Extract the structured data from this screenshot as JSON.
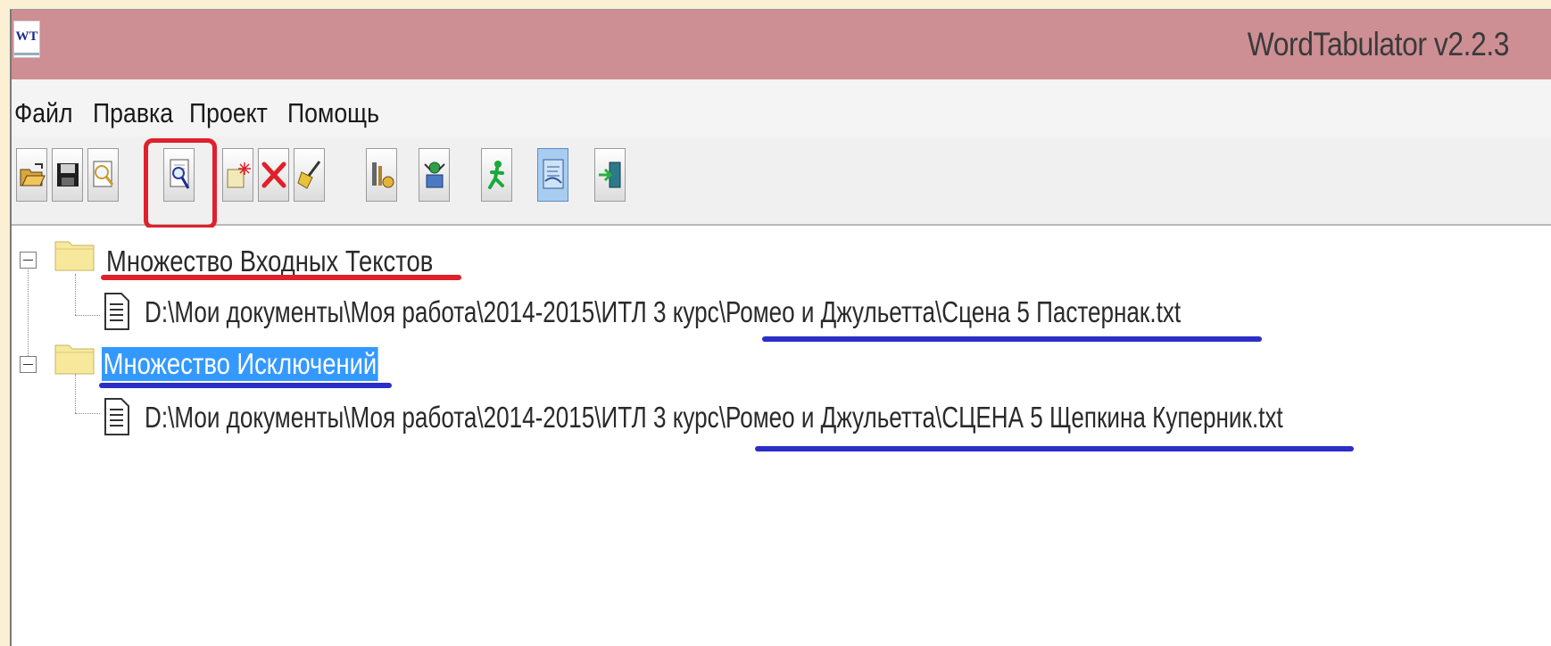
{
  "window": {
    "title": "WordTabulator v2.2.3",
    "icon_text": "WT"
  },
  "menu": [
    "Файл",
    "Правка",
    "Проект",
    "Помощь"
  ],
  "toolbar": {
    "buttons": [
      "open-folder-icon",
      "save-icon",
      "preview-icon",
      "search-document-icon",
      "new-item-icon",
      "delete-icon",
      "clear-icon",
      "tools-icon",
      "settings-icon",
      "run-icon",
      "document-view-icon",
      "exit-icon"
    ],
    "highlighted": "search-document-icon",
    "pressed": "document-view-icon"
  },
  "tree": {
    "nodes": [
      {
        "label": "Множество Входных Текстов",
        "selected": false,
        "children": [
          "D:\\Мои документы\\Моя работа\\2014-2015\\ИТЛ 3 курс\\Ромео и Джульетта\\Сцена 5 Пастернак.txt"
        ]
      },
      {
        "label": "Множество Исключений",
        "selected": true,
        "children": [
          "D:\\Мои документы\\Моя работа\\2014-2015\\ИТЛ 3 курс\\Ромео и Джульетта\\СЦЕНА 5 Щепкина Куперник.txt"
        ]
      }
    ]
  },
  "colors": {
    "titlebar": "#cd8e94",
    "selection": "#3399ff",
    "highlight_box": "#e0202a",
    "red_underline": "#e0202a",
    "blue_underline": "#2b2fc7"
  }
}
